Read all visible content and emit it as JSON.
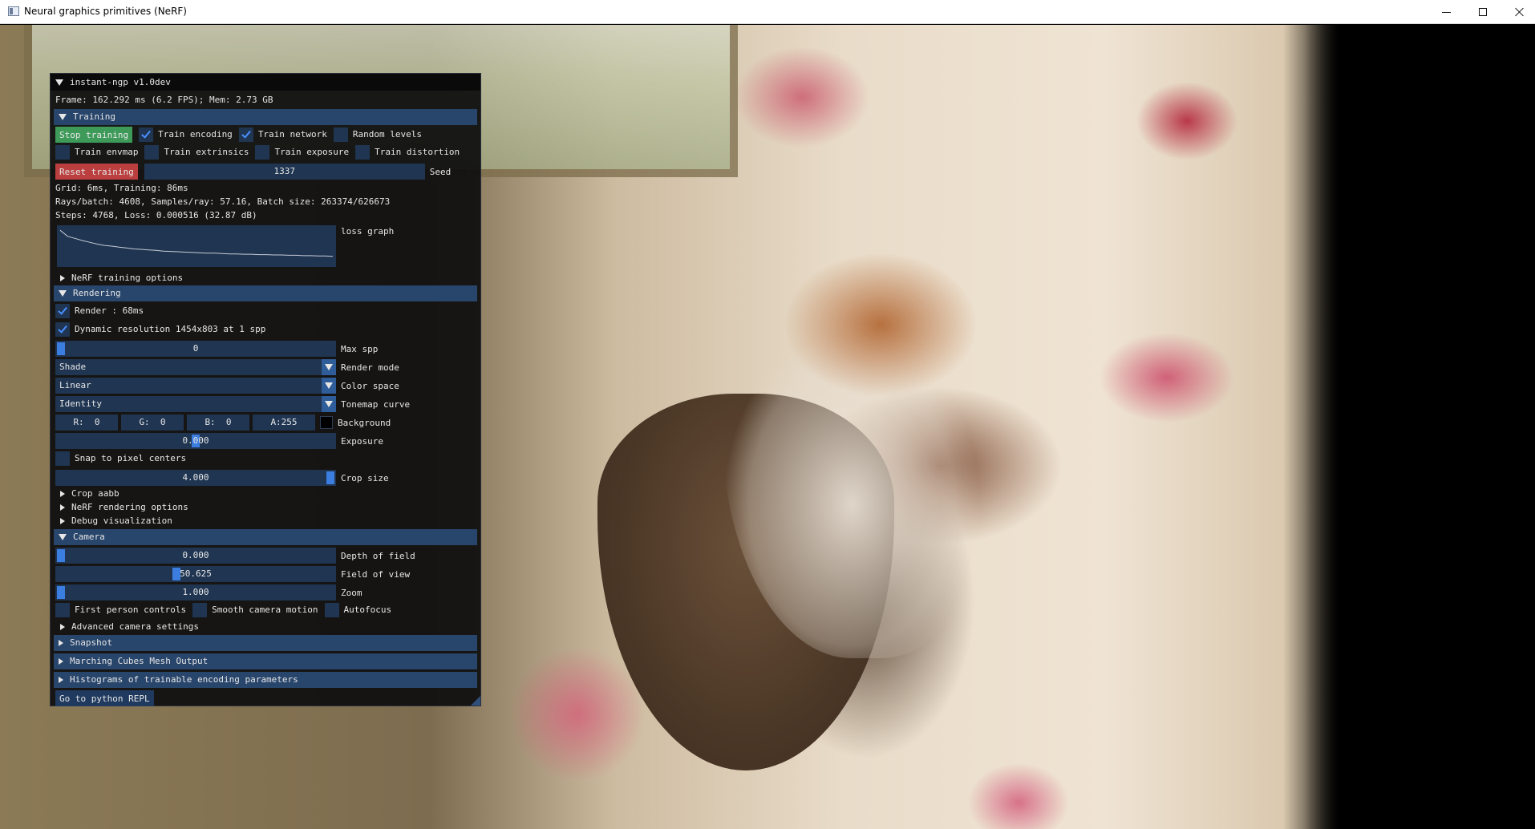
{
  "window": {
    "title": "Neural graphics primitives (NeRF)",
    "icons": {
      "app": "app-window-icon",
      "minimize": "minimize-icon",
      "maximize": "maximize-icon",
      "close": "close-icon"
    }
  },
  "panel": {
    "title": "instant-ngp v1.0dev",
    "stats": "Frame: 162.292 ms (6.2 FPS); Mem: 2.73 GB",
    "training": {
      "header": "Training",
      "stop_label": "Stop training",
      "train_encoding": "Train encoding",
      "train_network": "Train network",
      "random_levels": "Random levels",
      "train_envmap": "Train envmap",
      "train_extrinsics": "Train extrinsics",
      "train_exposure": "Train exposure",
      "train_distortion": "Train distortion",
      "reset_label": "Reset training",
      "seed_value": "1337",
      "seed_label": "Seed",
      "timing": "Grid: 6ms, Training: 86ms",
      "rays": "Rays/batch: 4608, Samples/ray: 57.16, Batch size: 263374/626673",
      "steps": "Steps: 4768, Loss: 0.000516 (32.87 dB)",
      "loss_graph_label": "loss graph",
      "nerf_options": "NeRF training options"
    },
    "rendering": {
      "header": "Rendering",
      "render": "Render : 68ms",
      "dynamic_res": "Dynamic resolution 1454x803 at 1 spp",
      "max_spp_value": "0",
      "max_spp_label": "Max spp",
      "render_mode_value": "Shade",
      "render_mode_label": "Render mode",
      "color_space_value": "Linear",
      "color_space_label": "Color space",
      "tonemap_value": "Identity",
      "tonemap_label": "Tonemap curve",
      "bg_r": "R:  0",
      "bg_g": "G:  0",
      "bg_b": "B:  0",
      "bg_a": "A:255",
      "bg_label": "Background",
      "exposure_value": "0.000",
      "exposure_label": "Exposure",
      "snap": "Snap to pixel centers",
      "crop_value": "4.000",
      "crop_label": "Crop size",
      "crop_aabb": "Crop aabb",
      "nerf_render_opts": "NeRF rendering options",
      "debug_vis": "Debug visualization"
    },
    "camera": {
      "header": "Camera",
      "dof_value": "0.000",
      "dof_label": "Depth of field",
      "fov_value": "50.625",
      "fov_label": "Field of view",
      "zoom_value": "1.000",
      "zoom_label": "Zoom",
      "first_person": "First person controls",
      "smooth_motion": "Smooth camera motion",
      "autofocus": "Autofocus",
      "advanced": "Advanced camera settings"
    },
    "snapshot": "Snapshot",
    "marching_cubes": "Marching Cubes Mesh Output",
    "histograms": "Histograms of trainable encoding parameters",
    "python_repl": "Go to python REPL"
  },
  "colors": {
    "panel_bg": "#0f0f0f",
    "header_bg": "#28456b",
    "frame_bg": "#1f3551",
    "accent": "#3c7de0",
    "stop_green": "#3e9a59",
    "reset_red": "#bb3f3f"
  },
  "loss_curve": [
    0.95,
    0.78,
    0.72,
    0.66,
    0.61,
    0.56,
    0.52,
    0.5,
    0.47,
    0.45,
    0.42,
    0.41,
    0.39,
    0.38,
    0.36,
    0.35,
    0.34,
    0.33,
    0.32,
    0.31,
    0.3,
    0.3,
    0.29,
    0.28,
    0.28,
    0.27,
    0.27,
    0.26,
    0.26,
    0.25,
    0.25,
    0.24,
    0.24,
    0.23,
    0.23,
    0.22,
    0.22,
    0.21
  ]
}
